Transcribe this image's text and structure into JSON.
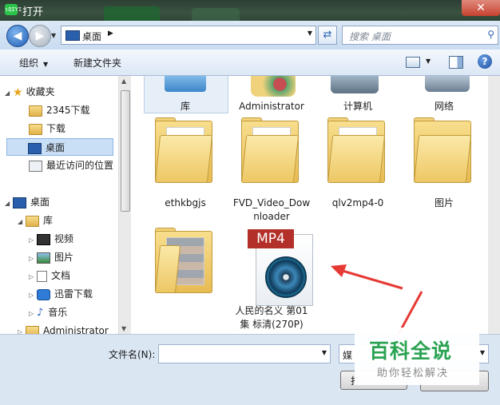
{
  "window": {
    "title": "打开",
    "close_label": "✕",
    "app_icon_text": "ιQIYI"
  },
  "address": {
    "location": "桌面",
    "search_placeholder": "搜索 桌面"
  },
  "toolbar": {
    "organize": "组织",
    "new_folder": "新建文件夹"
  },
  "nav_pane": {
    "favorites": "收藏夹",
    "fav_items": [
      "2345下载",
      "下载",
      "桌面",
      "最近访问的位置"
    ],
    "tree_desktop": "桌面",
    "libraries": "库",
    "lib_items": [
      "视频",
      "图片",
      "文档",
      "迅雷下载",
      "音乐"
    ],
    "admin": "Administrator"
  },
  "files": {
    "row1": [
      "库",
      "Administrator",
      "计算机",
      "网络"
    ],
    "folders": [
      {
        "label": "ethkbgjs"
      },
      {
        "label_line1": "FVD_Video_Dow",
        "label_line2": "nloader"
      },
      {
        "label": "qlv2mp4-0"
      },
      {
        "label": "图片"
      }
    ],
    "mp4": {
      "badge": "MP4",
      "line1": "人民的名义 第01",
      "line2": "集 标清(270P)"
    }
  },
  "bottom": {
    "filename_label": "文件名(N):",
    "filename_value": "",
    "filetype_value": "媒",
    "open_label": "打"
  },
  "watermark": {
    "title": "百科全说",
    "subtitle": "助你轻松解决"
  }
}
